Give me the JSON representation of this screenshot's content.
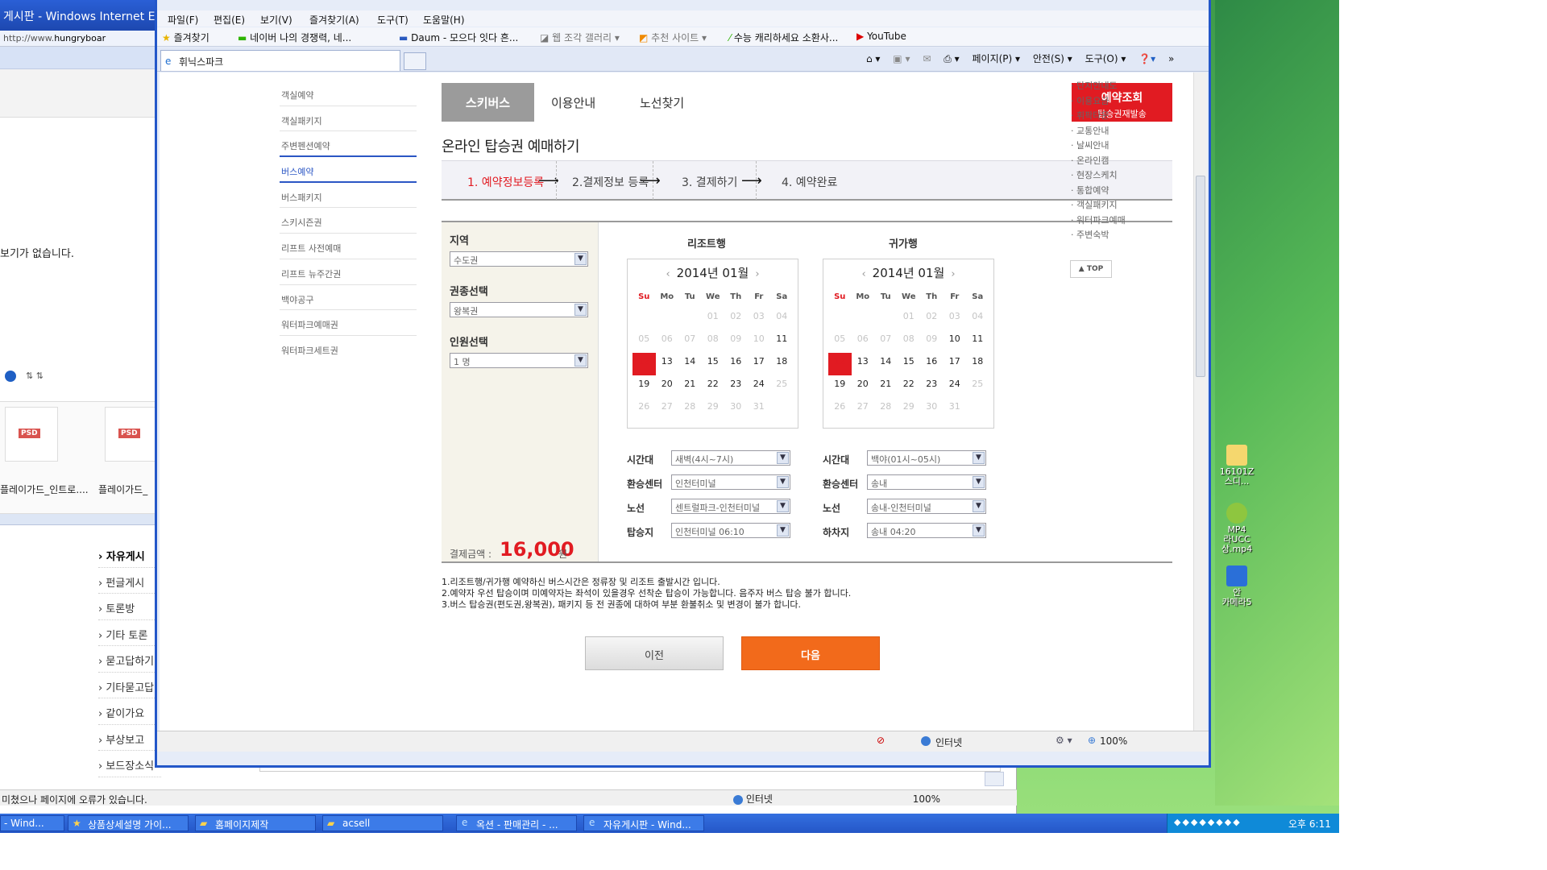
{
  "desktop": {
    "icons": [
      {
        "label": "16101Z\n스디...",
        "icon": "folder-icon"
      },
      {
        "label": "MP4\n라UCC\n상.mp4",
        "icon": "video-file-icon"
      },
      {
        "label": "안\n카메라5",
        "icon": "app-icon"
      }
    ]
  },
  "bg_window": {
    "title": "게시판 - Windows Internet E",
    "address_prefix": "http://www.",
    "address_host": "hungryboar",
    "no_display_text": "보기가 없습니다.",
    "files": [
      {
        "tag": "PSD",
        "caption": "플레이가드_인트로...."
      },
      {
        "tag": "PSD",
        "caption": "플레이가드_"
      }
    ],
    "forum_items": [
      "자유게시",
      "펀글게시",
      "토론방",
      "기타 토론",
      "묻고답하기",
      "기타묻고답",
      "같이가요",
      "부상보고",
      "보드장소식"
    ],
    "status_text": "미쳤으나 페이지에 오류가 있습니다.",
    "status_zone": "인터넷",
    "status_zoom": "100%"
  },
  "main_window": {
    "menu": [
      "파일(F)",
      "편집(E)",
      "보기(V)",
      "즐겨찾기(A)",
      "도구(T)",
      "도움말(H)"
    ],
    "favorites": {
      "label": "즐겨찾기",
      "items": [
        "네이버 나의 경쟁력, 네...",
        "Daum - 모으다 잇다 흔...",
        "웹 조각 갤러리 ▾",
        "추천 사이트 ▾",
        "수능 캐리하세요 소환사...",
        "YouTube"
      ]
    },
    "tab_title": "휘닉스파크",
    "commands": [
      "페이지(P) ▾",
      "안전(S) ▾",
      "도구(O) ▾"
    ],
    "status_zone": "인터넷",
    "status_zoom": "100%"
  },
  "page": {
    "left_nav": [
      "객실예약",
      "객실패키지",
      "주변펜션예약",
      "버스예약",
      "버스패키지",
      "스키시즌권",
      "리프트 사전예매",
      "리프트 뉴주간권",
      "백야공구",
      "워터파크예매권",
      "워터파크세트권"
    ],
    "tabs": {
      "ski_bus": "스키버스",
      "guide": "이용안내",
      "route": "노선찾기",
      "reserve_line1": "예약조회",
      "reserve_line2": "탑승권재발송"
    },
    "title": "온라인 탑승권 예매하기",
    "steps": [
      "1. 예약정보등록",
      "2.결제정보 등록",
      "3. 결제하기",
      "4. 예약완료"
    ],
    "form": {
      "region_label": "지역",
      "region_value": "수도권",
      "ticket_label": "권종선택",
      "ticket_value": "왕복권",
      "people_label": "인원선택",
      "people_value": "1 명",
      "price_label": "결제금액 :",
      "price_value": "16,000",
      "price_unit": "원"
    },
    "outbound": {
      "title": "리조트행",
      "month": "2014년 01월",
      "time_label": "시간대",
      "time_value": "새벽(4시~7시)",
      "transfer_label": "환승센터",
      "transfer_value": "인천터미널",
      "route_label": "노선",
      "route_value": "센트럴파크-인천터미널",
      "stop_label": "탑승지",
      "stop_value": "인천터미널 06:10"
    },
    "inbound": {
      "title": "귀가행",
      "month": "2014년 01월",
      "time_label": "시간대",
      "time_value": "백야(01시~05시)",
      "transfer_label": "환승센터",
      "transfer_value": "송내",
      "route_label": "노선",
      "route_value": "송내-인천터미널",
      "stop_label": "하차지",
      "stop_value": "송내 04:20"
    },
    "calendar": {
      "dow": [
        "Su",
        "Mo",
        "Tu",
        "We",
        "Th",
        "Fr",
        "Sa"
      ],
      "nav_prev": "‹",
      "nav_next": "›"
    },
    "notes": [
      "1.리조트행/귀가행 예약하신 버스시간은 정류장 및 리조트 출발시간 입니다.",
      "2.예약자 우선 탑승이며 미예약자는 좌석이 있을경우 선착순 탑승이 가능합니다. 음주자 버스 탑승 불가 합니다.",
      "3.버스 탑승권(편도권,왕복권), 패키지 등 전 권종에 대하여 부분 환불취소 및 변경이 불가 합니다."
    ],
    "buttons": {
      "prev": "이전",
      "next": "다음"
    },
    "right_links": [
      "· 단지안내도",
      "· 이용요금",
      "· 휘팍타운",
      "· 교통안내",
      "· 날씨안내",
      "· 온라인캠",
      "· 현장스케치",
      "· 통합예약",
      "· 객실패키지",
      "· 워터파크예매",
      "· 주변숙박"
    ],
    "top_button": "▲ TOP"
  },
  "taskbar": {
    "tasks": [
      "- Wind...",
      "상품상세설명 가이...",
      "홈페이지제작",
      "acsell",
      "옥션 - 판매관리 - ...",
      "자유게시판 - Wind..."
    ],
    "clock": "오후 6:11"
  }
}
